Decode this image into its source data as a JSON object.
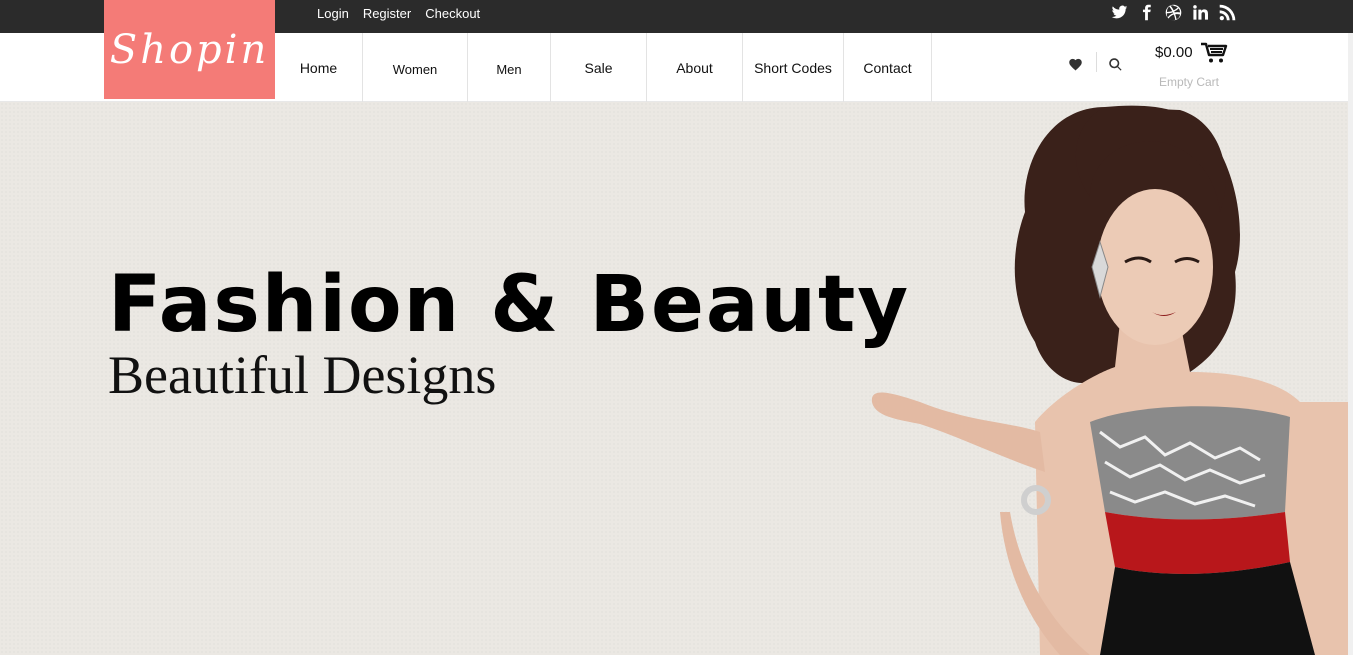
{
  "topbar": {
    "links": [
      "Login",
      "Register",
      "Checkout"
    ],
    "social_icons": [
      "twitter-icon",
      "facebook-icon",
      "dribbble-icon",
      "linkedin-icon",
      "rss-icon"
    ]
  },
  "logo": {
    "text": "Shopin"
  },
  "nav": {
    "items": [
      "Home",
      "Women",
      "Men",
      "Sale",
      "About",
      "Short Codes",
      "Contact"
    ]
  },
  "header": {
    "wishlist_icon": "heart-icon",
    "search_icon": "search-icon",
    "cart_amount": "$0.00",
    "cart_icon": "cart-icon",
    "cart_status": "Empty Cart"
  },
  "hero": {
    "title": "Fashion & Beauty",
    "subtitle": "Beautiful Designs"
  },
  "colors": {
    "brand": "#f47b77",
    "topbar": "#2b2b2b",
    "hero_bg": "#ebe8e3"
  }
}
